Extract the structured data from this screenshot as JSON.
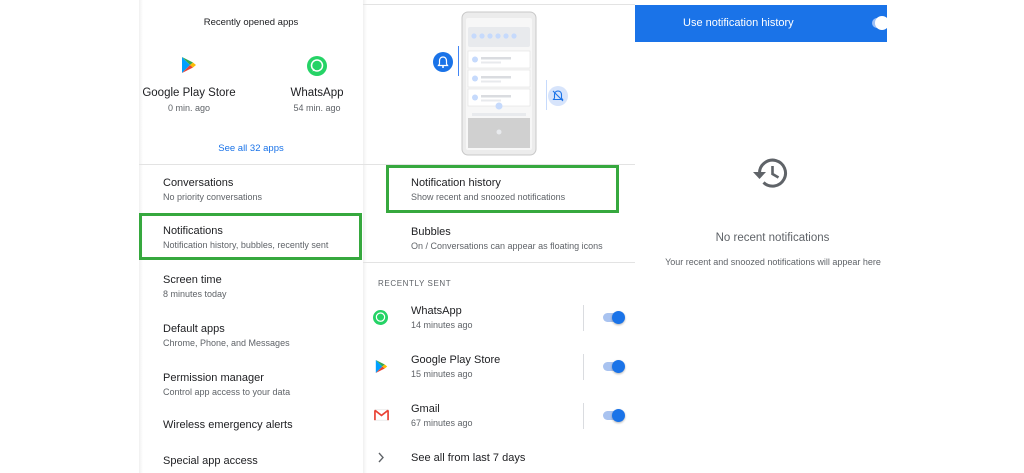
{
  "apps_panel": {
    "header": "Recently opened apps",
    "apps": [
      {
        "name": "Google Play Store",
        "time": "0 min. ago",
        "icon": "play-store-icon"
      },
      {
        "name": "WhatsApp",
        "time": "54 min. ago",
        "icon": "whatsapp-icon"
      }
    ],
    "see_all": "See all 32 apps",
    "items": [
      {
        "title": "Conversations",
        "sub": "No priority conversations"
      },
      {
        "title": "Notifications",
        "sub": "Notification history, bubbles, recently sent"
      },
      {
        "title": "Screen time",
        "sub": "8 minutes today"
      },
      {
        "title": "Default apps",
        "sub": "Chrome, Phone, and Messages"
      },
      {
        "title": "Permission manager",
        "sub": "Control app access to your data"
      },
      {
        "title": "Wireless emergency alerts",
        "sub": ""
      },
      {
        "title": "Special app access",
        "sub": ""
      }
    ]
  },
  "notifications_panel": {
    "history": {
      "title": "Notification history",
      "sub": "Show recent and snoozed notifications"
    },
    "bubbles": {
      "title": "Bubbles",
      "sub": "On / Conversations can appear as floating icons"
    },
    "recently_sent_header": "RECENTLY SENT",
    "recent": [
      {
        "name": "WhatsApp",
        "time": "14 minutes ago",
        "icon": "whatsapp-icon",
        "enabled": true
      },
      {
        "name": "Google Play Store",
        "time": "15 minutes ago",
        "icon": "play-store-icon",
        "enabled": true
      },
      {
        "name": "Gmail",
        "time": "67 minutes ago",
        "icon": "gmail-icon",
        "enabled": true
      }
    ],
    "see_all": "See all from last 7 days"
  },
  "history_panel": {
    "bar_label": "Use notification history",
    "enabled": true,
    "empty_title": "No recent notifications",
    "empty_sub": "Your recent and snoozed notifications will appear here",
    "icon": "history-icon"
  },
  "colors": {
    "accent": "#1a73e8",
    "highlight": "#36a83e",
    "whatsapp": "#25d366",
    "gmail": "#ea4335"
  }
}
